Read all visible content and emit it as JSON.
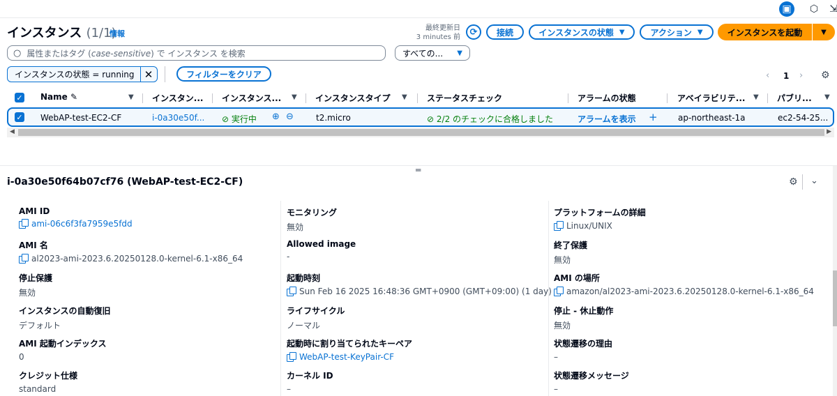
{
  "topbar": {
    "icons": [
      "panel-icon",
      "settings-hex-icon",
      "export-icon"
    ]
  },
  "header": {
    "title": "インスタンス",
    "count": "(1/1)",
    "info": "情報",
    "last_updated_label": "最終更新日",
    "last_updated_value": "3 minutes 前",
    "connect": "接続",
    "instance_state": "インスタンスの状態",
    "actions": "アクション",
    "launch": "インスタンスを起動"
  },
  "search": {
    "placeholder_prefix": "属性またはタグ (",
    "placeholder_italic": "case-sensitive",
    "placeholder_suffix": ") で インスタンス を検索",
    "select_value": "すべての..."
  },
  "filter": {
    "token": "インスタンスの状態 = running",
    "clear": "フィルターをクリア",
    "page": "1"
  },
  "table": {
    "headers": [
      "Name",
      "インスタン...",
      "インスタンス...",
      "インスタンスタイプ",
      "ステータスチェック",
      "アラームの状態",
      "アベイラビリテ...",
      "パブリ..."
    ],
    "row": {
      "name": "WebAP-test-EC2-CF",
      "instance_id": "i-0a30e50f...",
      "state": "実行中",
      "type": "t2.micro",
      "status_check": "2/2 のチェックに合格しました",
      "alarm": "アラームを表示",
      "az": "ap-northeast-1a",
      "public": "ec2-54-25..."
    }
  },
  "detail": {
    "title": "i-0a30e50f64b07cf76 (WebAP-test-EC2-CF)",
    "col1": [
      {
        "k": "AMI ID",
        "v": "ami-06c6f3fa7959e5fdd",
        "link": true,
        "copy": true
      },
      {
        "k": "AMI 名",
        "v": "al2023-ami-2023.6.20250128.0-kernel-6.1-x86_64",
        "link": false,
        "copy": true
      },
      {
        "k": "停止保護",
        "v": "無効",
        "link": false,
        "copy": false
      },
      {
        "k": "インスタンスの自動復旧",
        "v": "デフォルト",
        "link": false,
        "copy": false
      },
      {
        "k": "AMI 起動インデックス",
        "v": "0",
        "link": false,
        "copy": false
      },
      {
        "k": "クレジット仕様",
        "v": "standard",
        "link": false,
        "copy": false
      }
    ],
    "col2": [
      {
        "k": "モニタリング",
        "v": "無効",
        "link": false,
        "copy": false
      },
      {
        "k": "Allowed image",
        "v": "-",
        "link": false,
        "copy": false
      },
      {
        "k": "起動時刻",
        "v": "Sun Feb 16 2025 16:48:36 GMT+0900 (GMT+09:00) (1 day)",
        "link": false,
        "copy": true
      },
      {
        "k": "ライフサイクル",
        "v": "ノーマル",
        "link": false,
        "copy": false
      },
      {
        "k": "起動時に割り当てられたキーペア",
        "v": "WebAP-test-KeyPair-CF",
        "link": true,
        "copy": true
      },
      {
        "k": "カーネル ID",
        "v": "–",
        "link": false,
        "copy": false
      }
    ],
    "col3": [
      {
        "k": "プラットフォームの詳細",
        "v": "Linux/UNIX",
        "link": false,
        "copy": true
      },
      {
        "k": "終了保護",
        "v": "無効",
        "link": false,
        "copy": false
      },
      {
        "k": "AMI の場所",
        "v": "amazon/al2023-ami-2023.6.20250128.0-kernel-6.1-x86_64",
        "link": false,
        "copy": true
      },
      {
        "k": "停止 - 休止動作",
        "v": "無効",
        "link": false,
        "copy": false
      },
      {
        "k": "状態遷移の理由",
        "v": "–",
        "link": false,
        "copy": false
      },
      {
        "k": "状態遷移メッセージ",
        "v": "–",
        "link": false,
        "copy": false
      }
    ]
  }
}
